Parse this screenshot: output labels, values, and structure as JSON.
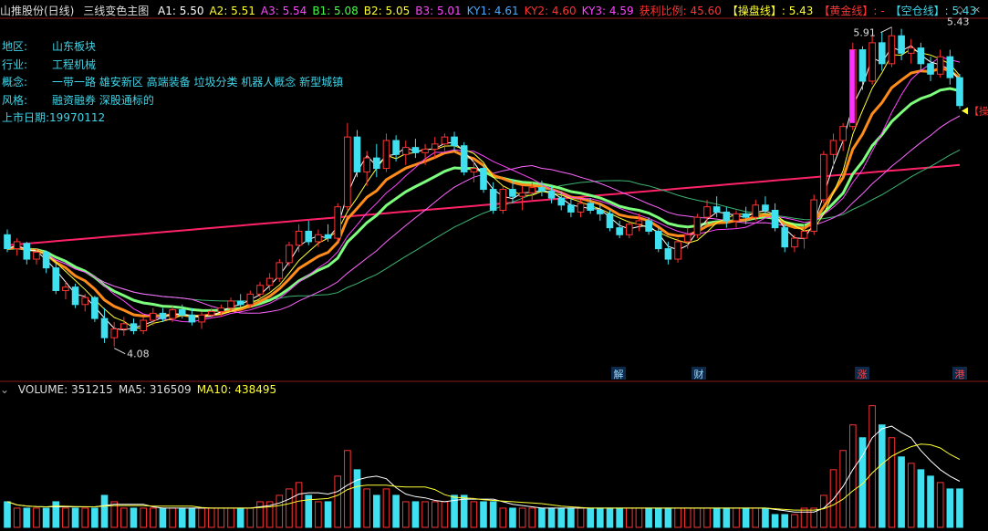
{
  "header": {
    "stock": "山推股份(日线)",
    "formula": "三线变色主图",
    "items": [
      {
        "label": "A1:",
        "value": "5.50",
        "color": "#ffffff"
      },
      {
        "label": "A2:",
        "value": "5.51",
        "color": "#ffff33"
      },
      {
        "label": "A3:",
        "value": "5.54",
        "color": "#ff44ff"
      },
      {
        "label": "B1:",
        "value": "5.08",
        "color": "#44ff44"
      },
      {
        "label": "B2:",
        "value": "5.05",
        "color": "#ffff33"
      },
      {
        "label": "B3:",
        "value": "5.01",
        "color": "#ff44ff"
      },
      {
        "label": "KY1:",
        "value": "4.61",
        "color": "#4aa8ff"
      },
      {
        "label": "KY2:",
        "value": "4.60",
        "color": "#ff3333"
      },
      {
        "label": "KY3:",
        "value": "4.59",
        "color": "#ff44ff"
      },
      {
        "label": "获利比例:",
        "value": "45.60",
        "color": "#ff3333"
      },
      {
        "label": "【操盘线】:",
        "value": "5.43",
        "color": "#ffff33"
      },
      {
        "label": "【黄金线】:",
        "value": "-",
        "color": "#ff3333"
      },
      {
        "label": "【空仓线】:",
        "value": "5.43",
        "color": "#3fd5e8"
      }
    ]
  },
  "info": {
    "rows": [
      {
        "key": "地区:",
        "value": "山东板块"
      },
      {
        "key": "行业:",
        "value": "工程机械"
      },
      {
        "key": "概念:",
        "value": "一带一路 雄安新区 高端装备 垃圾分类 机器人概念 新型城镇"
      },
      {
        "key": "风格:",
        "value": "融资融券 深股通标的"
      },
      {
        "key": "上市日期:",
        "value": "19970112"
      }
    ]
  },
  "annotations": {
    "high_label": "5.91",
    "low_label": "4.08",
    "last_price_label": "5.43",
    "right_edge_label": "【操盘",
    "event_markers": [
      "解",
      "财",
      "涨",
      "港"
    ]
  },
  "volume_header": {
    "items": [
      {
        "label": "VOLUME:",
        "value": "351215",
        "color": "#dddddd"
      },
      {
        "label": "MA5:",
        "value": "316509",
        "color": "#dddddd"
      },
      {
        "label": "MA10:",
        "value": "438495",
        "color": "#ffff33"
      }
    ]
  },
  "colors": {
    "up": "#ff3333",
    "down": "#3fe0f0",
    "bg": "#000000",
    "ma_fast": "#ffffff",
    "ma_mid": "#ffff33",
    "ma_slow": "#ff44ff",
    "trade_line": "#ff8c1a",
    "long_line": "#ff2266",
    "vol_ma5": "#ffffff",
    "vol_ma10": "#ffff33"
  },
  "chart_data": {
    "type": "candlestick",
    "title": "",
    "y_range": [
      4.0,
      5.95
    ],
    "candles": [
      {
        "o": 4.72,
        "h": 4.75,
        "l": 4.62,
        "c": 4.64
      },
      {
        "o": 4.64,
        "h": 4.7,
        "l": 4.6,
        "c": 4.68
      },
      {
        "o": 4.67,
        "h": 4.68,
        "l": 4.55,
        "c": 4.58
      },
      {
        "o": 4.58,
        "h": 4.64,
        "l": 4.55,
        "c": 4.62
      },
      {
        "o": 4.62,
        "h": 4.63,
        "l": 4.5,
        "c": 4.53
      },
      {
        "o": 4.53,
        "h": 4.56,
        "l": 4.38,
        "c": 4.4
      },
      {
        "o": 4.4,
        "h": 4.45,
        "l": 4.35,
        "c": 4.42
      },
      {
        "o": 4.42,
        "h": 4.44,
        "l": 4.3,
        "c": 4.32
      },
      {
        "o": 4.32,
        "h": 4.38,
        "l": 4.28,
        "c": 4.36
      },
      {
        "o": 4.36,
        "h": 4.37,
        "l": 4.22,
        "c": 4.24
      },
      {
        "o": 4.24,
        "h": 4.3,
        "l": 4.1,
        "c": 4.13
      },
      {
        "o": 4.13,
        "h": 4.22,
        "l": 4.08,
        "c": 4.18
      },
      {
        "o": 4.18,
        "h": 4.25,
        "l": 4.14,
        "c": 4.21
      },
      {
        "o": 4.21,
        "h": 4.24,
        "l": 4.15,
        "c": 4.17
      },
      {
        "o": 4.17,
        "h": 4.25,
        "l": 4.15,
        "c": 4.23
      },
      {
        "o": 4.23,
        "h": 4.3,
        "l": 4.2,
        "c": 4.27
      },
      {
        "o": 4.27,
        "h": 4.3,
        "l": 4.22,
        "c": 4.24
      },
      {
        "o": 4.24,
        "h": 4.31,
        "l": 4.22,
        "c": 4.29
      },
      {
        "o": 4.29,
        "h": 4.32,
        "l": 4.24,
        "c": 4.26
      },
      {
        "o": 4.26,
        "h": 4.3,
        "l": 4.2,
        "c": 4.22
      },
      {
        "o": 4.22,
        "h": 4.28,
        "l": 4.18,
        "c": 4.26
      },
      {
        "o": 4.26,
        "h": 4.3,
        "l": 4.24,
        "c": 4.28
      },
      {
        "o": 4.28,
        "h": 4.32,
        "l": 4.25,
        "c": 4.3
      },
      {
        "o": 4.3,
        "h": 4.36,
        "l": 4.28,
        "c": 4.34
      },
      {
        "o": 4.34,
        "h": 4.38,
        "l": 4.3,
        "c": 4.32
      },
      {
        "o": 4.32,
        "h": 4.4,
        "l": 4.3,
        "c": 4.38
      },
      {
        "o": 4.38,
        "h": 4.45,
        "l": 4.36,
        "c": 4.43
      },
      {
        "o": 4.43,
        "h": 4.5,
        "l": 4.4,
        "c": 4.47
      },
      {
        "o": 4.47,
        "h": 4.58,
        "l": 4.45,
        "c": 4.56
      },
      {
        "o": 4.56,
        "h": 4.68,
        "l": 4.54,
        "c": 4.66
      },
      {
        "o": 4.66,
        "h": 4.78,
        "l": 4.62,
        "c": 4.74
      },
      {
        "o": 4.74,
        "h": 4.8,
        "l": 4.66,
        "c": 4.68
      },
      {
        "o": 4.68,
        "h": 4.75,
        "l": 4.65,
        "c": 4.72
      },
      {
        "o": 4.72,
        "h": 4.78,
        "l": 4.68,
        "c": 4.7
      },
      {
        "o": 4.7,
        "h": 4.9,
        "l": 4.68,
        "c": 4.88
      },
      {
        "o": 4.88,
        "h": 5.36,
        "l": 4.86,
        "c": 5.28
      },
      {
        "o": 5.28,
        "h": 5.32,
        "l": 5.05,
        "c": 5.08
      },
      {
        "o": 5.08,
        "h": 5.2,
        "l": 5.0,
        "c": 5.16
      },
      {
        "o": 5.16,
        "h": 5.24,
        "l": 5.05,
        "c": 5.1
      },
      {
        "o": 5.1,
        "h": 5.3,
        "l": 5.08,
        "c": 5.26
      },
      {
        "o": 5.26,
        "h": 5.29,
        "l": 5.14,
        "c": 5.18
      },
      {
        "o": 5.18,
        "h": 5.26,
        "l": 5.12,
        "c": 5.22
      },
      {
        "o": 5.22,
        "h": 5.27,
        "l": 5.16,
        "c": 5.19
      },
      {
        "o": 5.19,
        "h": 5.24,
        "l": 5.12,
        "c": 5.21
      },
      {
        "o": 5.21,
        "h": 5.28,
        "l": 5.16,
        "c": 5.24
      },
      {
        "o": 5.24,
        "h": 5.3,
        "l": 5.2,
        "c": 5.28
      },
      {
        "o": 5.28,
        "h": 5.31,
        "l": 5.2,
        "c": 5.23
      },
      {
        "o": 5.23,
        "h": 5.25,
        "l": 5.06,
        "c": 5.08
      },
      {
        "o": 5.08,
        "h": 5.14,
        "l": 5.02,
        "c": 5.1
      },
      {
        "o": 5.1,
        "h": 5.12,
        "l": 4.96,
        "c": 4.98
      },
      {
        "o": 4.98,
        "h": 5.02,
        "l": 4.84,
        "c": 4.86
      },
      {
        "o": 4.86,
        "h": 5.0,
        "l": 4.84,
        "c": 4.98
      },
      {
        "o": 4.98,
        "h": 5.04,
        "l": 4.9,
        "c": 4.94
      },
      {
        "o": 4.94,
        "h": 5.0,
        "l": 4.86,
        "c": 4.96
      },
      {
        "o": 4.96,
        "h": 5.02,
        "l": 4.92,
        "c": 4.99
      },
      {
        "o": 4.99,
        "h": 5.03,
        "l": 4.94,
        "c": 4.97
      },
      {
        "o": 4.97,
        "h": 5.0,
        "l": 4.9,
        "c": 4.93
      },
      {
        "o": 4.93,
        "h": 4.97,
        "l": 4.86,
        "c": 4.89
      },
      {
        "o": 4.89,
        "h": 4.93,
        "l": 4.82,
        "c": 4.85
      },
      {
        "o": 4.85,
        "h": 4.92,
        "l": 4.82,
        "c": 4.9
      },
      {
        "o": 4.9,
        "h": 4.93,
        "l": 4.84,
        "c": 4.86
      },
      {
        "o": 4.86,
        "h": 4.9,
        "l": 4.8,
        "c": 4.84
      },
      {
        "o": 4.84,
        "h": 4.86,
        "l": 4.74,
        "c": 4.76
      },
      {
        "o": 4.76,
        "h": 4.8,
        "l": 4.7,
        "c": 4.72
      },
      {
        "o": 4.72,
        "h": 4.8,
        "l": 4.7,
        "c": 4.78
      },
      {
        "o": 4.78,
        "h": 4.84,
        "l": 4.74,
        "c": 4.8
      },
      {
        "o": 4.8,
        "h": 4.82,
        "l": 4.72,
        "c": 4.74
      },
      {
        "o": 4.74,
        "h": 4.76,
        "l": 4.62,
        "c": 4.64
      },
      {
        "o": 4.64,
        "h": 4.68,
        "l": 4.55,
        "c": 4.58
      },
      {
        "o": 4.58,
        "h": 4.7,
        "l": 4.56,
        "c": 4.68
      },
      {
        "o": 4.68,
        "h": 4.76,
        "l": 4.64,
        "c": 4.72
      },
      {
        "o": 4.72,
        "h": 4.84,
        "l": 4.7,
        "c": 4.82
      },
      {
        "o": 4.82,
        "h": 4.92,
        "l": 4.78,
        "c": 4.88
      },
      {
        "o": 4.88,
        "h": 4.94,
        "l": 4.82,
        "c": 4.85
      },
      {
        "o": 4.85,
        "h": 4.88,
        "l": 4.76,
        "c": 4.8
      },
      {
        "o": 4.8,
        "h": 4.86,
        "l": 4.76,
        "c": 4.84
      },
      {
        "o": 4.84,
        "h": 4.88,
        "l": 4.78,
        "c": 4.82
      },
      {
        "o": 4.82,
        "h": 4.92,
        "l": 4.8,
        "c": 4.89
      },
      {
        "o": 4.89,
        "h": 4.94,
        "l": 4.84,
        "c": 4.86
      },
      {
        "o": 4.86,
        "h": 4.9,
        "l": 4.74,
        "c": 4.76
      },
      {
        "o": 4.76,
        "h": 4.78,
        "l": 4.62,
        "c": 4.65
      },
      {
        "o": 4.65,
        "h": 4.72,
        "l": 4.62,
        "c": 4.7
      },
      {
        "o": 4.7,
        "h": 4.78,
        "l": 4.64,
        "c": 4.74
      },
      {
        "o": 4.74,
        "h": 4.95,
        "l": 4.72,
        "c": 4.92
      },
      {
        "o": 4.92,
        "h": 5.2,
        "l": 4.9,
        "c": 5.18
      },
      {
        "o": 5.18,
        "h": 5.3,
        "l": 5.1,
        "c": 5.26
      },
      {
        "o": 5.26,
        "h": 5.36,
        "l": 5.2,
        "c": 5.34
      },
      {
        "o": 5.34,
        "h": 5.82,
        "l": 5.32,
        "c": 5.78
      },
      {
        "o": 5.78,
        "h": 5.8,
        "l": 5.55,
        "c": 5.6
      },
      {
        "o": 5.6,
        "h": 5.86,
        "l": 5.58,
        "c": 5.82
      },
      {
        "o": 5.82,
        "h": 5.88,
        "l": 5.66,
        "c": 5.7
      },
      {
        "o": 5.7,
        "h": 5.91,
        "l": 5.68,
        "c": 5.86
      },
      {
        "o": 5.86,
        "h": 5.9,
        "l": 5.72,
        "c": 5.76
      },
      {
        "o": 5.76,
        "h": 5.84,
        "l": 5.7,
        "c": 5.79
      },
      {
        "o": 5.79,
        "h": 5.82,
        "l": 5.66,
        "c": 5.7
      },
      {
        "o": 5.7,
        "h": 5.74,
        "l": 5.6,
        "c": 5.64
      },
      {
        "o": 5.64,
        "h": 5.78,
        "l": 5.62,
        "c": 5.74
      },
      {
        "o": 5.74,
        "h": 5.78,
        "l": 5.58,
        "c": 5.62
      },
      {
        "o": 5.62,
        "h": 5.64,
        "l": 5.44,
        "c": 5.46
      }
    ],
    "volume": [
      4,
      3,
      3,
      3,
      3,
      4,
      3,
      3,
      3,
      3,
      5,
      4,
      3,
      3,
      3,
      3,
      3,
      3,
      3,
      3,
      3,
      3,
      3,
      3,
      3,
      3,
      4,
      4,
      5,
      6,
      7,
      5,
      4,
      4,
      8,
      12,
      9,
      6,
      5,
      6,
      5,
      4,
      4,
      4,
      4,
      4,
      5,
      5,
      4,
      4,
      4,
      3,
      3,
      3,
      3,
      3,
      3,
      3,
      3,
      3,
      3,
      3,
      3,
      3,
      3,
      3,
      3,
      3,
      3,
      3,
      3,
      3,
      3,
      3,
      3,
      3,
      3,
      3,
      3,
      2,
      2,
      2,
      3,
      3,
      5,
      9,
      12,
      16,
      14,
      19,
      16,
      14,
      11,
      10,
      9,
      8,
      7,
      6,
      6
    ],
    "volume_unit": "10k"
  }
}
